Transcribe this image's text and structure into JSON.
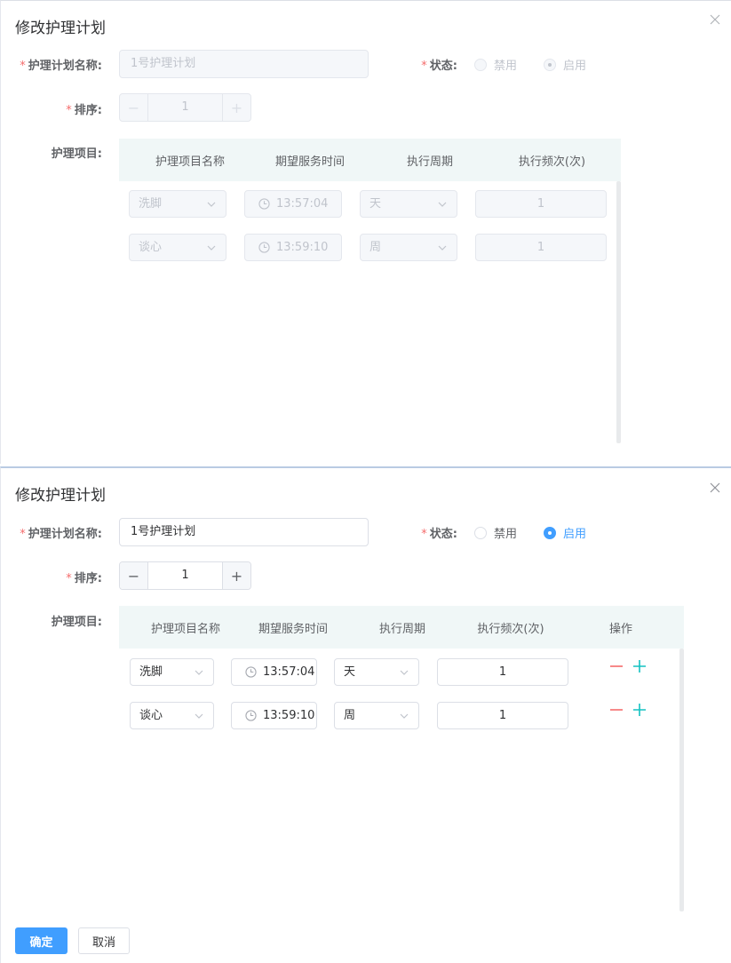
{
  "dialogs": [
    {
      "title": "修改护理计划",
      "name_label": "护理计划名称:",
      "name_value": "1号护理计划",
      "status_label": "状态:",
      "status_options": [
        "禁用",
        "启用"
      ],
      "status_selected": "启用",
      "sort_label": "排序:",
      "sort_value": "1",
      "items_label": "护理项目:",
      "columns": [
        "护理项目名称",
        "期望服务时间",
        "执行周期",
        "执行频次(次)"
      ],
      "rows": [
        {
          "item": "洗脚",
          "time": "13:57:04",
          "period": "天",
          "frequency": "1"
        },
        {
          "item": "谈心",
          "time": "13:59:10",
          "period": "周",
          "frequency": "1"
        }
      ]
    },
    {
      "title": "修改护理计划",
      "name_label": "护理计划名称:",
      "name_value": "1号护理计划",
      "status_label": "状态:",
      "status_options": [
        "禁用",
        "启用"
      ],
      "status_selected": "启用",
      "sort_label": "排序:",
      "sort_value": "1",
      "items_label": "护理项目:",
      "columns": [
        "护理项目名称",
        "期望服务时间",
        "执行周期",
        "执行频次(次)",
        "操作"
      ],
      "rows": [
        {
          "item": "洗脚",
          "time": "13:57:04",
          "period": "天",
          "frequency": "1"
        },
        {
          "item": "谈心",
          "time": "13:59:10",
          "period": "周",
          "frequency": "1"
        }
      ],
      "confirm_label": "确定",
      "cancel_label": "取消"
    }
  ],
  "icons": {
    "close": "close-icon",
    "minus": "minus-icon",
    "plus": "plus-icon",
    "clock": "clock-icon",
    "chevron": "chevron-down-icon"
  },
  "colors": {
    "primary": "#409eff",
    "required": "#f56c6c",
    "add": "#13c2c2",
    "table_header_bg": "#f0f7f7"
  }
}
